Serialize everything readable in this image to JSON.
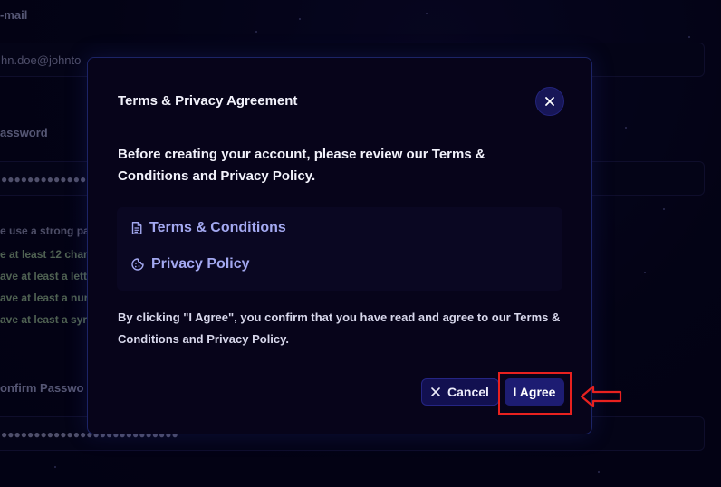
{
  "background_form": {
    "email_label": "-mail",
    "email_value": "hn.doe@johnto",
    "password_label": "assword",
    "password_dots": "●●●●●●●●●●●●●●●●●●●●●●●●●●●",
    "hints": [
      {
        "text": "e use a strong pa",
        "state": "muted"
      },
      {
        "text": "e at least 12 char",
        "state": "ok"
      },
      {
        "text": "ave at least a lett",
        "state": "ok"
      },
      {
        "text": "ave at least a nur",
        "state": "ok"
      },
      {
        "text": "ave at least a syr",
        "state": "ok"
      }
    ],
    "confirm_label": "onfirm Passwo",
    "confirm_dots": "●●●●●●●●●●●●●●●●●●●●●●●●●●●"
  },
  "modal": {
    "title": "Terms & Privacy Agreement",
    "intro": "Before creating your account, please review our Terms & Conditions and Privacy Policy.",
    "links": [
      {
        "label": "Terms & Conditions",
        "icon": "document-icon"
      },
      {
        "label": "Privacy Policy",
        "icon": "cookie-icon"
      }
    ],
    "confirm_text": "By clicking \"I Agree\", you confirm that you have read and agree to our Terms & Conditions and Privacy Policy.",
    "cancel_label": "Cancel",
    "agree_label": "I Agree"
  },
  "colors": {
    "link": "#a3a8f0",
    "button": "#1d1c72",
    "highlight": "#e8211f"
  }
}
